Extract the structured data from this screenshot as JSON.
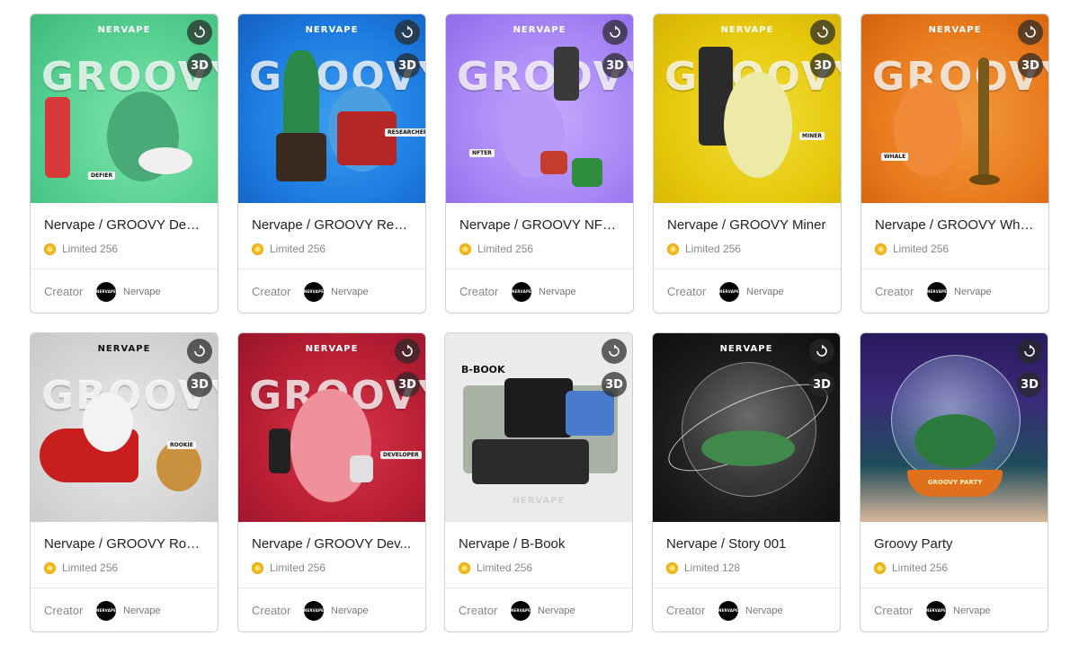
{
  "cards": [
    {
      "title": "Nervape / GROOVY DeFi...",
      "limit": "Limited 256",
      "creator_label": "Creator",
      "creator_name": "Nervape",
      "brand": "NERVAPE",
      "art_text": "GROOVY",
      "tag": "DEFIER",
      "badge": "3D"
    },
    {
      "title": "Nervape / GROOVY Rese...",
      "limit": "Limited 256",
      "creator_label": "Creator",
      "creator_name": "Nervape",
      "brand": "NERVAPE",
      "art_text": "GROOVY",
      "tag": "RESEARCHER",
      "badge": "3D"
    },
    {
      "title": "Nervape / GROOVY NFTer",
      "limit": "Limited 256",
      "creator_label": "Creator",
      "creator_name": "Nervape",
      "brand": "NERVAPE",
      "art_text": "GROOVY",
      "tag": "NFTER",
      "badge": "3D"
    },
    {
      "title": "Nervape / GROOVY Miner",
      "limit": "Limited 256",
      "creator_label": "Creator",
      "creator_name": "Nervape",
      "brand": "NERVAPE",
      "art_text": "GROOVY",
      "tag": "MINER",
      "badge": "3D"
    },
    {
      "title": "Nervape / GROOVY Whale",
      "limit": "Limited 256",
      "creator_label": "Creator",
      "creator_name": "Nervape",
      "brand": "NERVAPE",
      "art_text": "GROOVY",
      "tag": "WHALE",
      "badge": "3D"
    },
    {
      "title": "Nervape / GROOVY Roo...",
      "limit": "Limited 256",
      "creator_label": "Creator",
      "creator_name": "Nervape",
      "brand": "NERVAPE",
      "art_text": "GROOVY",
      "tag": "ROOKIE",
      "badge": "3D"
    },
    {
      "title": "Nervape / GROOVY Dev...",
      "limit": "Limited 256",
      "creator_label": "Creator",
      "creator_name": "Nervape",
      "brand": "NERVAPE",
      "art_text": "GROOVY",
      "tag": "DEVELOPER",
      "badge": "3D"
    },
    {
      "title": "Nervape / B-Book",
      "limit": "Limited 256",
      "creator_label": "Creator",
      "creator_name": "Nervape",
      "brand": "NERVAPE",
      "art_text": "B-BOOK",
      "badge": "3D"
    },
    {
      "title": "Nervape / Story 001",
      "limit": "Limited 128",
      "creator_label": "Creator",
      "creator_name": "Nervape",
      "brand": "NERVAPE",
      "badge": "3D"
    },
    {
      "title": "Groovy Party",
      "limit": "Limited 256",
      "creator_label": "Creator",
      "creator_name": "Nervape",
      "art_text": "GROOVY PARTY",
      "badge": "3D"
    }
  ],
  "avatar_text": "NERVAPE",
  "colors": {
    "coin": "#f2b91c",
    "border": "#cfcfcf",
    "muted": "#888888"
  }
}
